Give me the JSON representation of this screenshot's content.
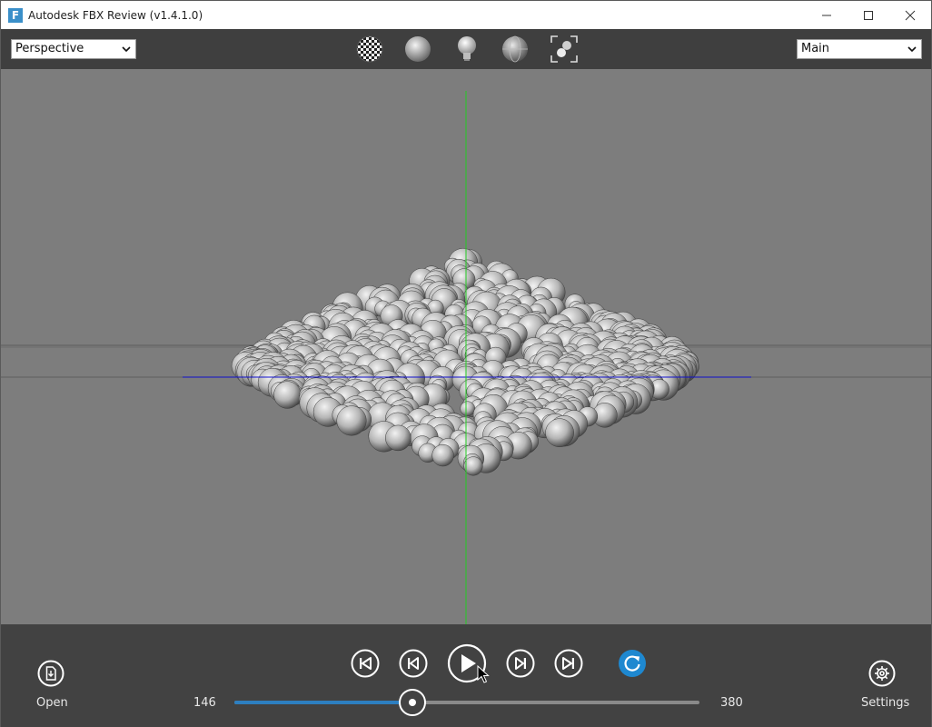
{
  "window": {
    "title": "Autodesk FBX Review (v1.4.1.0)",
    "logo_letter": "F"
  },
  "toolbar": {
    "camera_select": {
      "value": "Perspective"
    },
    "view_select": {
      "value": "Main"
    },
    "icons": [
      "checker-texture-icon",
      "shaded-sphere-icon",
      "light-bulb-icon",
      "wireframe-sphere-icon",
      "frame-all-icon"
    ]
  },
  "playback": {
    "start_frame": "146",
    "end_frame": "380",
    "progress": 0.383,
    "loop_color": "#1e88d0"
  },
  "bottom": {
    "open_label": "Open",
    "settings_label": "Settings"
  },
  "colors": {
    "accent": "#2d7fc0",
    "y_axis": "#22cc22",
    "x_axis": "#1010cc"
  }
}
